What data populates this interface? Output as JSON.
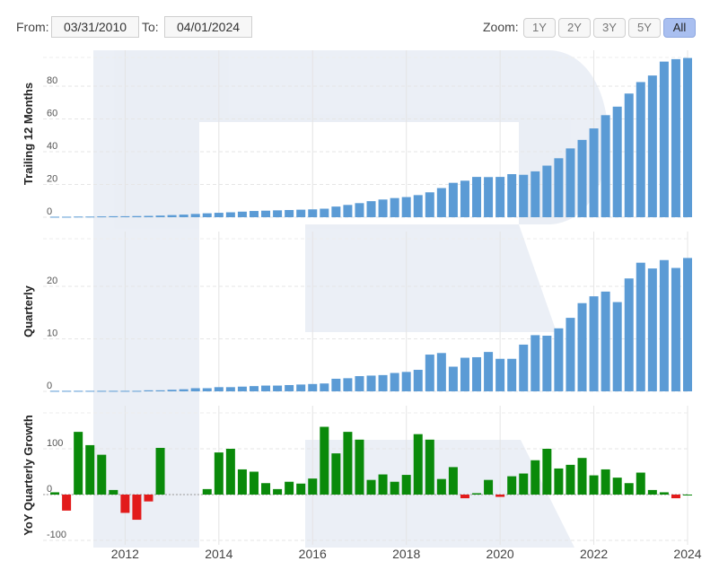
{
  "controls": {
    "from_label": "From:",
    "from_value": "03/31/2010",
    "to_label": "To:",
    "to_value": "04/01/2024",
    "zoom_label": "Zoom:",
    "zoom_options": [
      "1Y",
      "2Y",
      "3Y",
      "5Y",
      "All"
    ],
    "zoom_selected": "All"
  },
  "chart_data": {
    "type": "bar",
    "x_axis": {
      "range": [
        2010.25,
        2024.0
      ],
      "ticks": [
        "2012",
        "2014",
        "2016",
        "2018",
        "2020",
        "2022",
        "2024"
      ],
      "grid": true
    },
    "colors": {
      "bar": "#5b9bd5",
      "positive": "#0a8a0a",
      "negative": "#e21b1b",
      "grid": "#e4e4e4"
    },
    "panels": [
      {
        "ylabel": "Trailing 12 Months",
        "ylim": [
          0,
          100
        ],
        "yticks": [
          "0",
          "20",
          "40",
          "60",
          "80"
        ],
        "x": [
          2010.5,
          2010.75,
          2011.0,
          2011.25,
          2011.5,
          2011.75,
          2012.0,
          2012.25,
          2012.5,
          2012.75,
          2013.0,
          2013.25,
          2013.5,
          2013.75,
          2014.0,
          2014.25,
          2014.5,
          2014.75,
          2015.0,
          2015.25,
          2015.5,
          2015.75,
          2016.0,
          2016.25,
          2016.5,
          2016.75,
          2017.0,
          2017.25,
          2017.5,
          2017.75,
          2018.0,
          2018.25,
          2018.5,
          2018.75,
          2019.0,
          2019.25,
          2019.5,
          2019.75,
          2020.0,
          2020.25,
          2020.5,
          2020.75,
          2021.0,
          2021.25,
          2021.5,
          2021.75,
          2022.0,
          2022.25,
          2022.5,
          2022.75,
          2023.0,
          2023.25,
          2023.5,
          2023.75,
          2024.0
        ],
        "values": [
          0.3,
          0.3,
          0.4,
          0.4,
          0.5,
          0.6,
          0.6,
          0.7,
          0.8,
          1,
          1.3,
          1.6,
          2,
          2.4,
          2.7,
          3,
          3.4,
          3.8,
          4,
          4.2,
          4.4,
          4.6,
          4.8,
          5.2,
          6.5,
          7.5,
          8.6,
          9.8,
          10.8,
          11.7,
          12.3,
          13.5,
          15.2,
          17.8,
          21,
          22.3,
          24.6,
          24.5,
          24.6,
          26.3,
          25.9,
          28,
          31.5,
          36,
          42,
          47.2,
          54.2,
          62.3,
          67.5,
          75.5,
          82.5,
          86.5,
          95,
          96.5,
          97.2,
          95.5
        ]
      },
      {
        "ylabel": "Quarterly",
        "ylim": [
          0,
          30
        ],
        "yticks": [
          "0",
          "10",
          "20"
        ],
        "x": [
          2010.5,
          2010.75,
          2011.0,
          2011.25,
          2011.5,
          2011.75,
          2012.0,
          2012.25,
          2012.5,
          2012.75,
          2013.0,
          2013.25,
          2013.5,
          2013.75,
          2014.0,
          2014.25,
          2014.5,
          2014.75,
          2015.0,
          2015.25,
          2015.5,
          2015.75,
          2016.0,
          2016.25,
          2016.5,
          2016.75,
          2017.0,
          2017.25,
          2017.5,
          2017.75,
          2018.0,
          2018.25,
          2018.5,
          2018.75,
          2019.0,
          2019.25,
          2019.5,
          2019.75,
          2020.0,
          2020.25,
          2020.5,
          2020.75,
          2021.0,
          2021.25,
          2021.5,
          2021.75,
          2022.0,
          2022.25,
          2022.5,
          2022.75,
          2023.0,
          2023.25,
          2023.5,
          2023.75,
          2024.0
        ],
        "values": [
          0.1,
          0.1,
          0.1,
          0.1,
          0.1,
          0.1,
          0.1,
          0.1,
          0.2,
          0.2,
          0.3,
          0.4,
          0.6,
          0.6,
          0.8,
          0.8,
          0.9,
          1,
          1.1,
          1.1,
          1.2,
          1.3,
          1.4,
          1.5,
          2.4,
          2.5,
          2.9,
          3.0,
          3.1,
          3.5,
          3.7,
          4.1,
          7.0,
          7.3,
          4.7,
          6.4,
          6.5,
          7.5,
          6.2,
          6.2,
          8.9,
          10.7,
          10.6,
          12.0,
          14.0,
          16.8,
          18.1,
          19.0,
          17.0,
          21.5,
          24.5,
          23.4,
          25.0,
          23.5,
          25.4,
          21.5
        ]
      },
      {
        "ylabel": "YoY Quarterly Growth",
        "ylim": [
          -110,
          160
        ],
        "yticks": [
          "-100",
          "0",
          "100"
        ],
        "x": [
          2010.5,
          2010.75,
          2011.0,
          2011.25,
          2011.5,
          2011.75,
          2012.0,
          2012.25,
          2012.5,
          2012.75,
          2013.75,
          2014.0,
          2014.25,
          2014.5,
          2014.75,
          2015.0,
          2015.25,
          2015.5,
          2015.75,
          2016.0,
          2016.25,
          2016.5,
          2016.75,
          2017.0,
          2017.25,
          2017.5,
          2017.75,
          2018.0,
          2018.25,
          2018.5,
          2018.75,
          2019.0,
          2019.25,
          2019.5,
          2019.75,
          2020.0,
          2020.25,
          2020.5,
          2020.75,
          2021.0,
          2021.25,
          2021.5,
          2021.75,
          2022.0,
          2022.25,
          2022.5,
          2022.75,
          2023.0,
          2023.25,
          2023.5,
          2023.75,
          2024.0
        ],
        "values": [
          5,
          -35,
          137,
          108,
          87,
          10,
          -40,
          -55,
          -15,
          102,
          12,
          92,
          100,
          55,
          50,
          25,
          12,
          28,
          24,
          35,
          148,
          90,
          137,
          120,
          32,
          44,
          28,
          43,
          132,
          120,
          34,
          60,
          -8,
          3,
          32,
          -5,
          40,
          46,
          75,
          100,
          57,
          65,
          80,
          42,
          55,
          37,
          25,
          48,
          10,
          5,
          -8,
          0
        ]
      }
    ]
  }
}
